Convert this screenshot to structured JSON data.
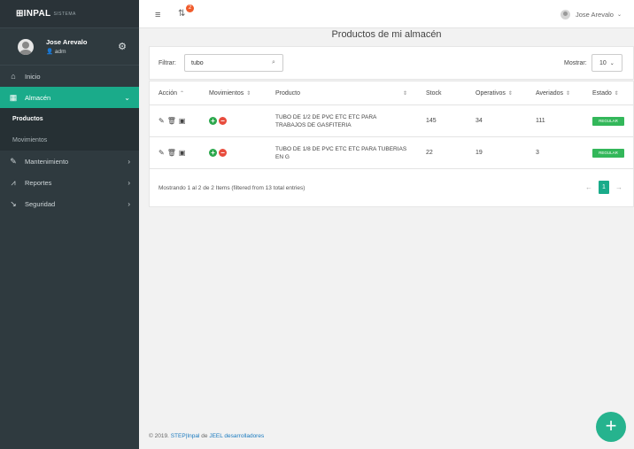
{
  "brand": {
    "logo": "⊞INPAL",
    "sub": "SISTEMA"
  },
  "profile": {
    "name": "Jose Arevalo",
    "role": "adm"
  },
  "sidebar": {
    "items": [
      {
        "label": "Inicio",
        "icon": "home-icon"
      },
      {
        "label": "Almacén",
        "icon": "warehouse-icon"
      },
      {
        "label": "Mantenimiento",
        "icon": "wrench-icon"
      },
      {
        "label": "Reportes",
        "icon": "chart-icon"
      },
      {
        "label": "Seguridad",
        "icon": "shield-icon"
      }
    ],
    "sub_items": [
      {
        "label": "Productos"
      },
      {
        "label": "Movimientos"
      }
    ]
  },
  "topbar": {
    "notification_count": "2",
    "user_name": "Jose Arevalo"
  },
  "main": {
    "title": "Productos de mi almacén",
    "filter": {
      "label": "Filtrar:",
      "value": "tubo"
    },
    "show": {
      "label": "Mostrar:",
      "value": "10"
    },
    "table": {
      "headers": [
        "Acción",
        "Movimientos",
        "Producto",
        "Stock",
        "Operativos",
        "Averiados",
        "Estado"
      ],
      "rows": [
        {
          "producto": "TUBO DE 1/2 DE PVC ETC ETC PARA TRABAJOS DE GASFITERIA",
          "stock": "145",
          "operativos": "34",
          "averiados": "111",
          "estado": "REGULAR"
        },
        {
          "producto": "TUBO DE 1/8 DE PVC ETC ETC PARA TUBERIAS EN G",
          "stock": "22",
          "operativos": "19",
          "averiados": "3",
          "estado": "REGULAR"
        }
      ]
    },
    "info": "Mostrando 1 al 2 de 2 Items (filtered from 13 total entries)",
    "pagination": {
      "current": "1"
    }
  },
  "footer": {
    "prefix": "© 2019.",
    "step": "STEP|Inpal",
    "de": "de",
    "company": "JEEL desarrolladores"
  },
  "colors": {
    "accent": "#1aab8a",
    "sidebar": "#2f3a3f",
    "badge": "#f05b2b",
    "estado": "#33b75a"
  }
}
